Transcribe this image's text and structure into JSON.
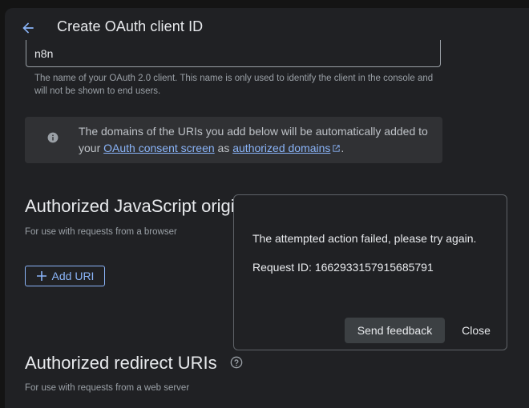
{
  "header": {
    "title": "Create OAuth client ID",
    "back_icon": "arrow-back-icon"
  },
  "name_field": {
    "value": "n8n",
    "hint": "The name of your OAuth 2.0 client. This name is only used to identify the client in the console and will not be shown to end users."
  },
  "info_box": {
    "icon": "info-icon",
    "text_before": "The domains of the URIs you add below will be automatically added to your ",
    "link1": "OAuth consent screen",
    "text_mid": " as ",
    "link2": "authorized domains",
    "text_after": "."
  },
  "js_origins": {
    "title": "Authorized JavaScript origins",
    "subtitle": "For use with requests from a browser",
    "add_button": "Add URI"
  },
  "redirect_uris": {
    "title": "Authorized redirect URIs",
    "subtitle": "For use with requests from a web server",
    "help_icon": "help-icon"
  },
  "dialog": {
    "message": "The attempted action failed, please try again.",
    "request_id": "Request ID: 1662933157915685791",
    "feedback_button": "Send feedback",
    "close_button": "Close"
  },
  "colors": {
    "background": "#202124",
    "accent": "#8ab4f8",
    "text": "#e8eaed",
    "muted_text": "#9aa0a6"
  }
}
